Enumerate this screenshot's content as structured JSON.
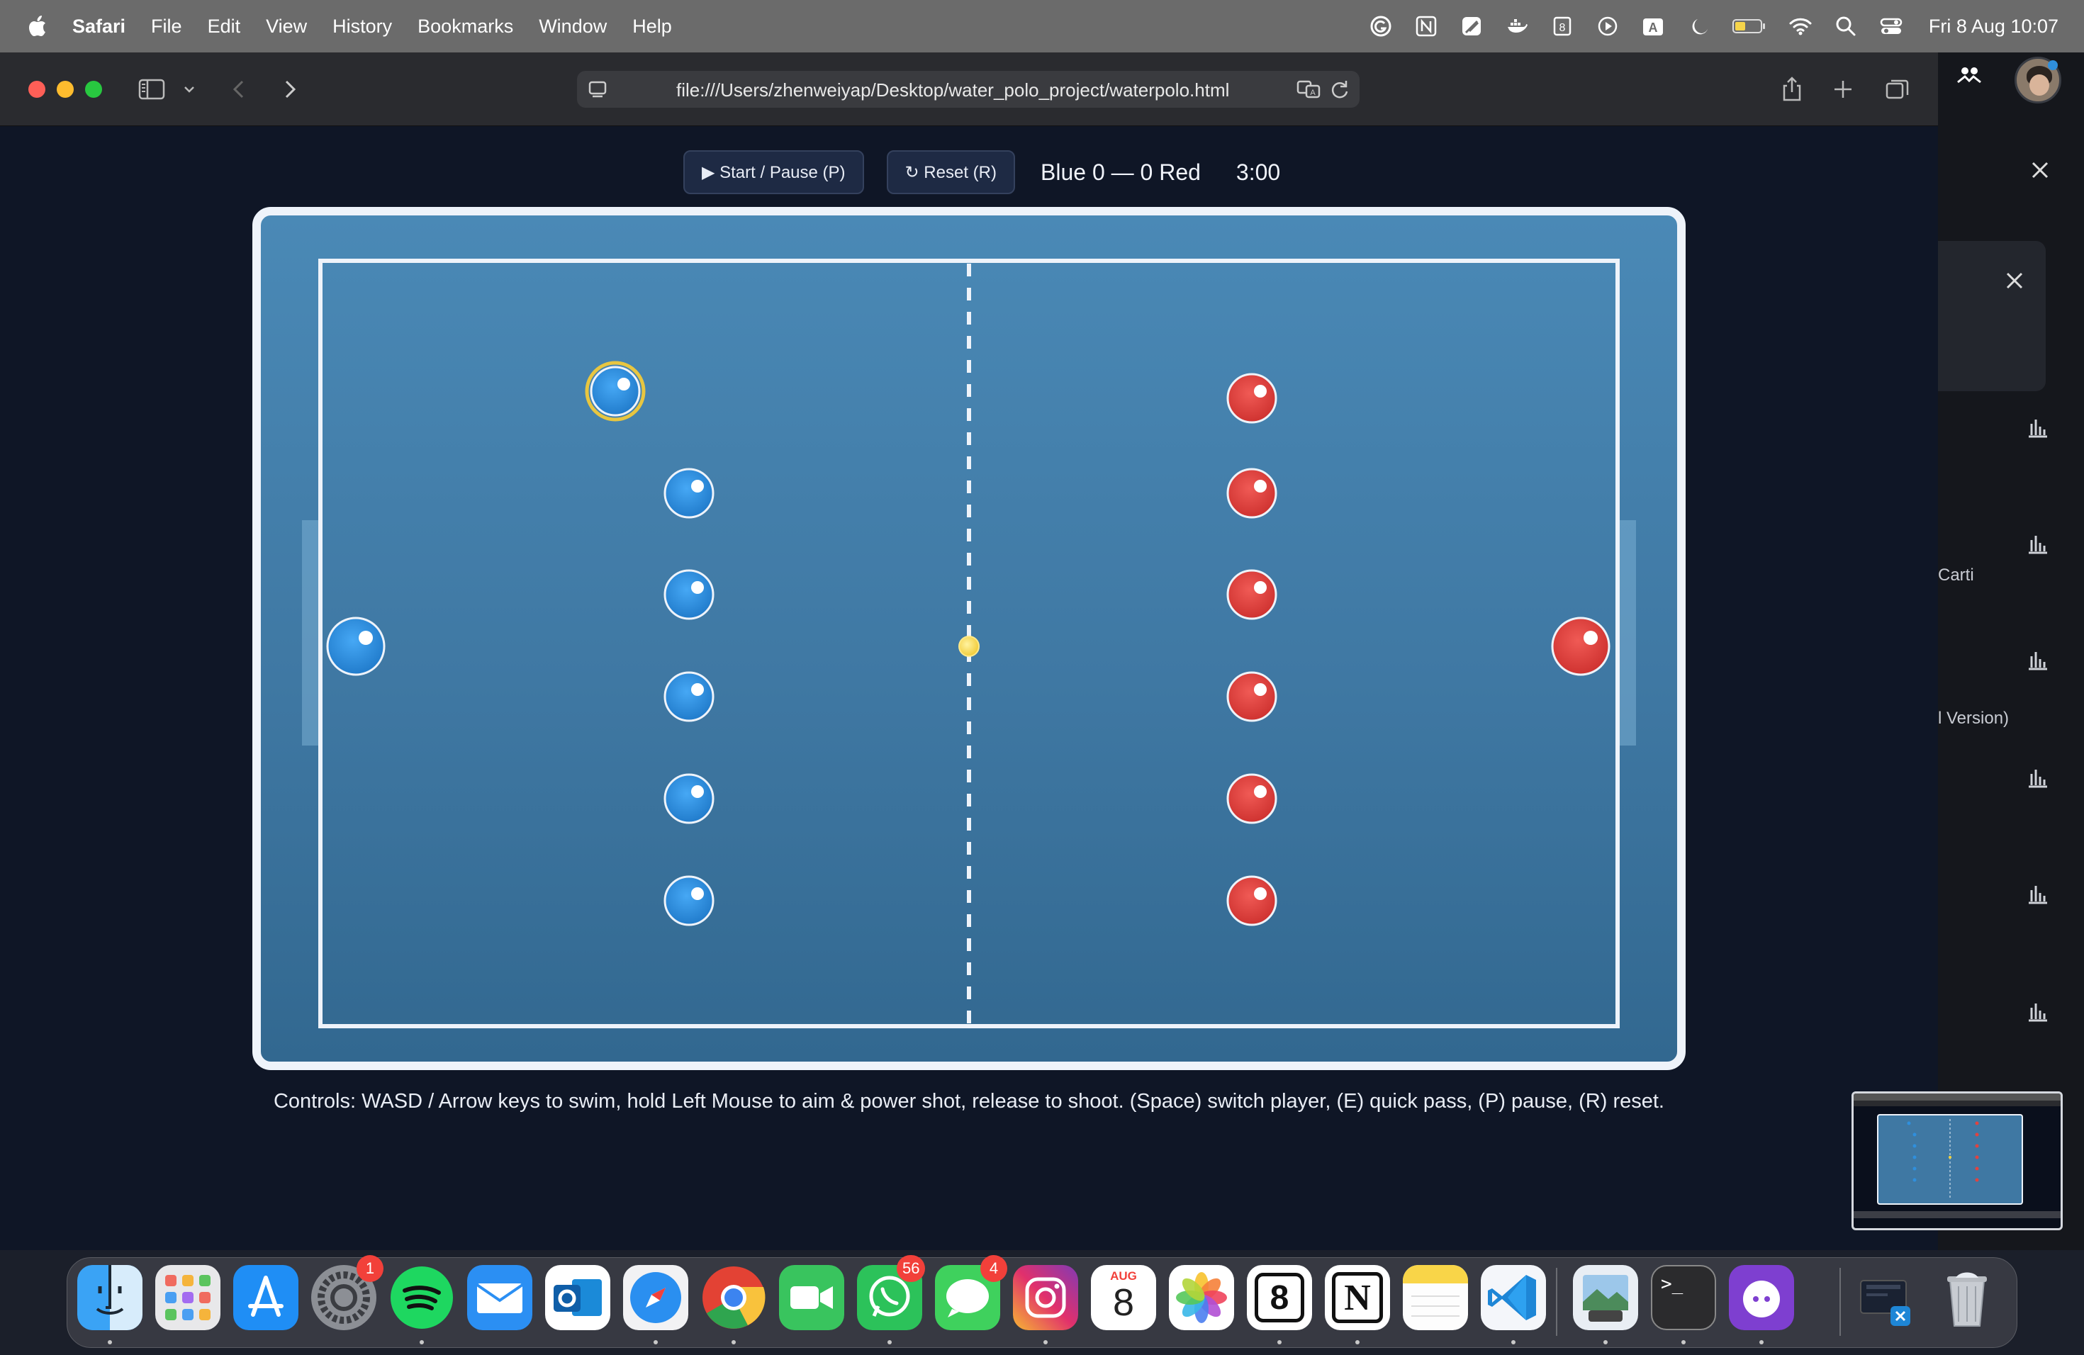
{
  "menubar": {
    "app_name": "Safari",
    "items": [
      "File",
      "Edit",
      "View",
      "History",
      "Bookmarks",
      "Window",
      "Help"
    ],
    "clock": "Fri 8 Aug  10:07",
    "status_icons": [
      "grammarly-icon",
      "notion-icon",
      "feather-icon",
      "docker-icon",
      "eight-icon",
      "play-icon",
      "keyboard-input-icon",
      "moon-icon",
      "battery-icon",
      "wifi-icon",
      "search-icon",
      "control-center-icon"
    ],
    "keyboard_label": "A"
  },
  "browser": {
    "url": "file:///Users/zhenweiyap/Desktop/water_polo_project/waterpolo.html"
  },
  "sidepanel": {
    "snippets": [
      "Carti",
      "l Version)"
    ]
  },
  "game": {
    "start_button": "▶ Start / Pause (P)",
    "reset_button": "↻ Reset (R)",
    "score": "Blue 0 — 0 Red",
    "timer": "3:00",
    "controls_text": "Controls: WASD / Arrow keys to swim, hold Left Mouse to aim & power shot, release to shoot. (Space) switch player, (E) quick pass, (P) pause, (R) reset.",
    "colors": {
      "blue_team": "#2f8fdd",
      "red_team": "#e2433f",
      "ball": "#f4d23a",
      "selected_ring": "#e8c640"
    }
  },
  "dock": {
    "apps": [
      {
        "name": "finder-icon"
      },
      {
        "name": "launchpad-icon"
      },
      {
        "name": "app-store-icon"
      },
      {
        "name": "system-settings-icon",
        "badge": "1"
      },
      {
        "name": "spotify-icon"
      },
      {
        "name": "mail-icon"
      },
      {
        "name": "outlook-icon"
      },
      {
        "name": "safari-icon"
      },
      {
        "name": "chrome-icon"
      },
      {
        "name": "facetime-icon"
      },
      {
        "name": "whatsapp-icon",
        "badge": "56"
      },
      {
        "name": "messages-icon",
        "badge": "4"
      },
      {
        "name": "instagram-icon"
      },
      {
        "name": "calendar-icon",
        "month": "AUG",
        "day": "8"
      },
      {
        "name": "photos-icon"
      },
      {
        "name": "eight-app-icon",
        "label": "8"
      },
      {
        "name": "notion-app-icon",
        "label": "N"
      },
      {
        "name": "notes-icon"
      },
      {
        "name": "vscode-icon"
      },
      {
        "name": "preview-icon"
      },
      {
        "name": "terminal-icon",
        "label": ">_"
      },
      {
        "name": "github-desktop-icon"
      },
      {
        "name": "downloads-stack-icon"
      },
      {
        "name": "trash-icon"
      }
    ]
  }
}
